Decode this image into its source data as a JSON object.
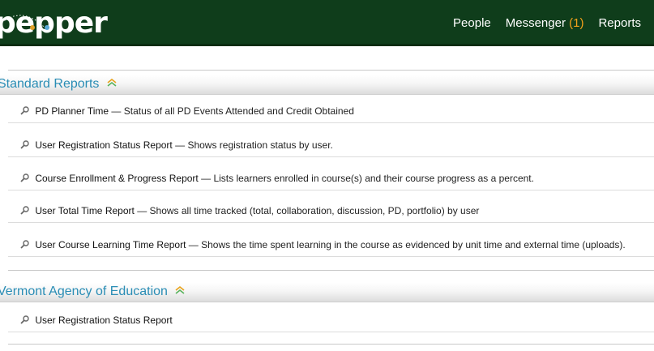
{
  "app": {
    "logo_text": "pepper"
  },
  "nav": {
    "people": "People",
    "messenger": "Messenger",
    "messenger_count": "(1)",
    "reports": "Reports"
  },
  "colors": {
    "header_bg": "#0f3d1b",
    "section_title": "#2a8db5",
    "badge": "#f3a11b"
  },
  "sections": [
    {
      "title": "Standard Reports",
      "reports": [
        {
          "name": "PD Planner Time",
          "desc": "Status of all PD Events Attended and Credit Obtained"
        },
        {
          "name": "User Registration Status Report",
          "desc": "Shows registration status by user."
        },
        {
          "name": "Course Enrollment & Progress Report",
          "desc": "Lists learners enrolled in course(s) and their course progress as a percent."
        },
        {
          "name": "User Total Time Report",
          "desc": "Shows all time tracked (total, collaboration, discussion, PD, portfolio) by user"
        },
        {
          "name": "User Course Learning Time Report",
          "desc": "Shows the time spent learning in the course as evidenced by unit time and external time (uploads)."
        }
      ]
    },
    {
      "title": "Vermont Agency of Education",
      "reports": [
        {
          "name": "User Registration Status Report",
          "desc": ""
        }
      ]
    }
  ],
  "icons": {
    "report": "magnifier-icon",
    "collapse": "double-chevron-up-icon"
  }
}
